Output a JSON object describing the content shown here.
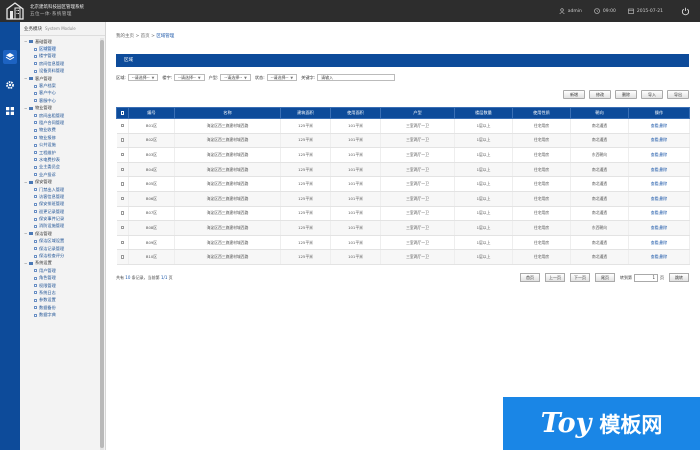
{
  "header": {
    "title_line1": "北京建筑科技园区管理系统",
    "title_line2": "五位一体·系统管理",
    "user": "admin",
    "time": "09:00",
    "date": "2015-07-21"
  },
  "sidebar": {
    "title": "业务模块",
    "title_en": "System Module",
    "groups": [
      {
        "label": "基础管理",
        "items": [
          "区域管理",
          "楼宇管理",
          "房间信息管理",
          "设备资料管理"
        ]
      },
      {
        "label": "客户管理",
        "items": [
          "客户档案",
          "客户中心",
          "客服中心"
        ]
      },
      {
        "label": "物业管理",
        "items": [
          "房间出租管理",
          "租户合同管理",
          "物业收费",
          "物业报修",
          "公共设施",
          "工程维护",
          "水电费抄表",
          "业主委员会",
          "业户投诉"
        ]
      },
      {
        "label": "保安管理",
        "items": [
          "门禁出入管理",
          "访客信息管理",
          "保安排班管理",
          "巡更记录管理",
          "保安事件记录",
          "消防设施管理"
        ]
      },
      {
        "label": "保洁管理",
        "items": [
          "保洁区域设置",
          "保洁记录管理",
          "保洁检查评分"
        ]
      },
      {
        "label": "系统设置",
        "items": [
          "用户管理",
          "角色管理",
          "权限管理",
          "系统日志",
          "参数设置",
          "数据备份",
          "数据字典"
        ]
      }
    ]
  },
  "breadcrumb": {
    "home": "我的主页",
    "sep1": ">",
    "level1": "首页",
    "sep2": ">",
    "current": "区域管理"
  },
  "panel": {
    "title": "区域"
  },
  "filters": {
    "label": "区域:",
    "selects": [
      {
        "label": "",
        "value": "--请选择--"
      },
      {
        "label": "楼宇:",
        "value": "--请选择--"
      },
      {
        "label": "户型:",
        "value": "--请选择--"
      },
      {
        "label": "状态:",
        "value": "--请选择--"
      }
    ],
    "keyword_label": "关键字:",
    "keyword_value": "请输入"
  },
  "actions": [
    "新增",
    "修改",
    "删除",
    "导入",
    "导出"
  ],
  "table": {
    "headers": [
      "",
      "编号",
      "名称",
      "建筑面积",
      "使用面积",
      "户型",
      "楼层数量",
      "使用性质",
      "朝向",
      "操作"
    ],
    "rows": [
      [
        "",
        "B01区",
        "海淀区西三旗建材城西路",
        "125平米",
        "101平米",
        "三室两厅一卫",
        "1层以上",
        "住宅用房",
        "南北通透",
        "查看|删除"
      ],
      [
        "",
        "B02区",
        "海淀区西三旗建材城西路",
        "125平米",
        "101平米",
        "三室两厅一卫",
        "1层以上",
        "住宅用房",
        "南北通透",
        "查看|删除"
      ],
      [
        "",
        "B03区",
        "海淀区西三旗建材城西路",
        "125平米",
        "101平米",
        "三室两厅一卫",
        "1层以上",
        "住宅用房",
        "东西朝向",
        "查看|删除"
      ],
      [
        "",
        "B04区",
        "海淀区西三旗建材城西路",
        "125平米",
        "101平米",
        "三室两厅一卫",
        "1层以上",
        "住宅用房",
        "南北通透",
        "查看|删除"
      ],
      [
        "",
        "B05区",
        "海淀区西三旗建材城西路",
        "125平米",
        "101平米",
        "三室两厅一卫",
        "1层以上",
        "住宅用房",
        "南北通透",
        "查看|删除"
      ],
      [
        "",
        "B06区",
        "海淀区西三旗建材城西路",
        "125平米",
        "101平米",
        "三室两厅一卫",
        "1层以上",
        "住宅用房",
        "南北通透",
        "查看|删除"
      ],
      [
        "",
        "B07区",
        "海淀区西三旗建材城西路",
        "125平米",
        "101平米",
        "三室两厅一卫",
        "1层以上",
        "住宅用房",
        "南北通透",
        "查看|删除"
      ],
      [
        "",
        "B08区",
        "海淀区西三旗建材城西路",
        "125平米",
        "101平米",
        "三室两厅一卫",
        "1层以上",
        "住宅用房",
        "东西朝向",
        "查看|删除"
      ],
      [
        "",
        "B09区",
        "海淀区西三旗建材城西路",
        "125平米",
        "101平米",
        "三室两厅一卫",
        "1层以上",
        "住宅用房",
        "南北通透",
        "查看|删除"
      ],
      [
        "",
        "B10区",
        "海淀区西三旗建材城西路",
        "125平米",
        "101平米",
        "三室两厅一卫",
        "1层以上",
        "住宅用房",
        "南北通透",
        "查看|删除"
      ]
    ]
  },
  "pagination": {
    "info_prefix": "共有",
    "total": "10",
    "info_mid": "条记录，当前第",
    "page": "1/1",
    "info_suffix": "页",
    "buttons": [
      "首页",
      "上一页",
      "下一页",
      "尾页"
    ],
    "jump_label": "转到第",
    "jump_value": "1",
    "jump_unit": "页",
    "jump_button": "跳转"
  },
  "watermark": {
    "latin": "Toy",
    "cjk": "模板网"
  }
}
